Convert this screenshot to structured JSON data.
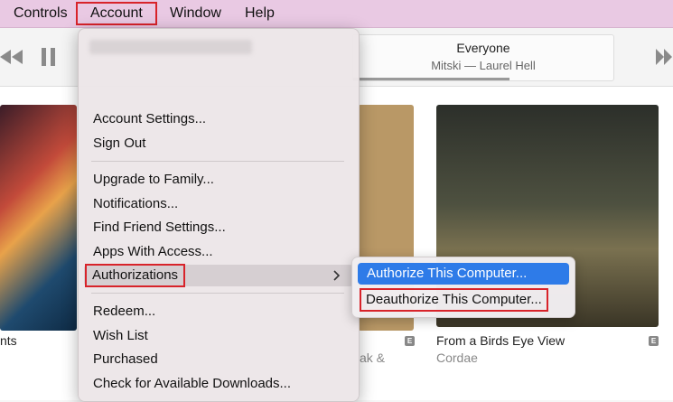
{
  "menubar": {
    "items": [
      "Controls",
      "Account",
      "Window",
      "Help"
    ]
  },
  "player": {
    "song": "Everyone",
    "artist_album": "Mitski — Laurel Hell",
    "progress": 0.6
  },
  "albums": [
    {
      "title": "nts",
      "artist": ""
    },
    {
      "title": "",
      "artist": "ak &"
    },
    {
      "title": "From a Birds Eye View",
      "artist": "Cordae"
    }
  ],
  "explicit_badge": "E",
  "account_menu": {
    "group1": [
      "Account Settings...",
      "Sign Out"
    ],
    "group2": [
      "Upgrade to Family...",
      "Notifications...",
      "Find Friend Settings...",
      "Apps With Access..."
    ],
    "authorizations": "Authorizations",
    "group3": [
      "Redeem...",
      "Wish List",
      "Purchased",
      "Check for Available Downloads..."
    ]
  },
  "auth_submenu": {
    "authorize": "Authorize This Computer...",
    "deauthorize": "Deauthorize This Computer..."
  },
  "icons": {
    "rewind": "rewind-icon",
    "pause": "pause-icon",
    "submenu_arrow": "chevron-right-icon"
  }
}
